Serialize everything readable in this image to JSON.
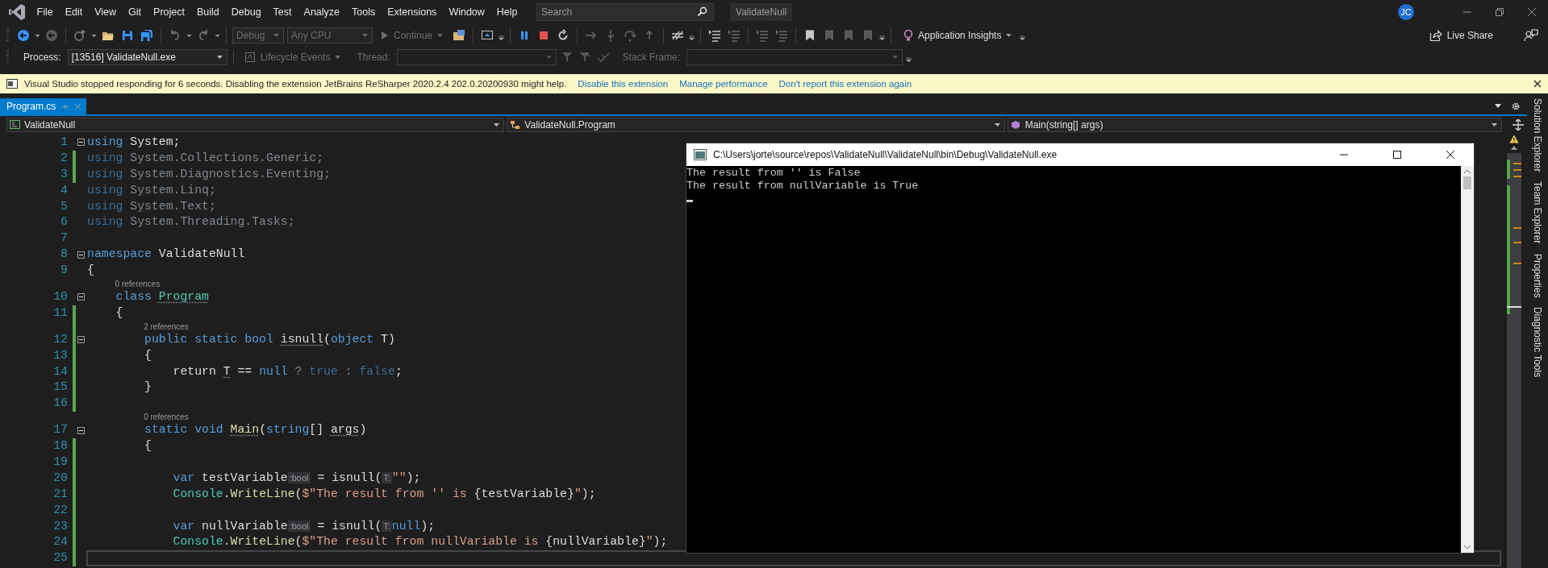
{
  "menu_bar": {
    "items": [
      "File",
      "Edit",
      "View",
      "Git",
      "Project",
      "Build",
      "Debug",
      "Test",
      "Analyze",
      "Tools",
      "Extensions",
      "Window",
      "Help"
    ],
    "search": {
      "placeholder": "Search"
    },
    "solution": "ValidateNull",
    "avatar": "JC"
  },
  "debug_toolbar": {
    "configuration": {
      "value": "Debug",
      "disabled": true
    },
    "platform": {
      "value": "Any CPU",
      "disabled": true
    },
    "continue": {
      "label": "Continue",
      "disabled": true
    },
    "insights": "Application Insights",
    "live_share": "Live Share"
  },
  "process_toolbar": {
    "process_label": "Process:",
    "process": "[13516] ValidateNull.exe",
    "lifecycle": {
      "label": "Lifecycle Events",
      "disabled": true
    },
    "thread_label": "Thread:",
    "stack_frame_label": "Stack Frame:"
  },
  "info_bar": {
    "message": "Visual Studio stopped responding for 6 seconds. Disabling the extension JetBrains ReSharper 2020.2.4 202.0.20200930 might help.",
    "links": [
      "Disable this extension",
      "Manage performance",
      "Don't report this extension again"
    ]
  },
  "tabs": [
    {
      "label": "Program.cs",
      "selected": true
    }
  ],
  "nav_bar": {
    "project": "ValidateNull",
    "type": "ValidateNull.Program",
    "member": "Main(string[] args)"
  },
  "editor": {
    "lines": [
      {
        "number": "1",
        "changed": false,
        "fold": true,
        "current": false,
        "tokens": [
          {
            "kind": "keyword",
            "text": "using"
          },
          {
            "kind": "plain",
            "text": " System;"
          }
        ]
      },
      {
        "number": "2",
        "changed": true,
        "fold": false,
        "current": false,
        "tokens": [
          {
            "kind": "dim-keyword",
            "text": "using"
          },
          {
            "kind": "dim",
            "text": " System.Collections.Generic;"
          }
        ]
      },
      {
        "number": "3",
        "changed": true,
        "fold": false,
        "current": false,
        "tokens": [
          {
            "kind": "dim-keyword",
            "text": "using"
          },
          {
            "kind": "dim",
            "text": " System.Diagnostics.Eventing;"
          }
        ]
      },
      {
        "number": "4",
        "changed": false,
        "fold": false,
        "current": false,
        "tokens": [
          {
            "kind": "dim-keyword",
            "text": "using"
          },
          {
            "kind": "dim",
            "text": " System.Linq;"
          }
        ]
      },
      {
        "number": "5",
        "changed": false,
        "fold": false,
        "current": false,
        "tokens": [
          {
            "kind": "dim-keyword",
            "text": "using"
          },
          {
            "kind": "dim",
            "text": " System.Text;"
          }
        ]
      },
      {
        "number": "6",
        "changed": false,
        "fold": false,
        "current": false,
        "tokens": [
          {
            "kind": "dim-keyword",
            "text": "using"
          },
          {
            "kind": "dim",
            "text": " System.Threading.Tasks;"
          }
        ]
      },
      {
        "number": "7",
        "changed": false,
        "fold": false,
        "current": false
      },
      {
        "number": "8",
        "changed": false,
        "fold": true,
        "current": false,
        "tokens": [
          {
            "kind": "keyword",
            "text": "namespace"
          },
          {
            "kind": "plain",
            "text": " ValidateNull"
          }
        ]
      },
      {
        "number": "9",
        "changed": false,
        "fold": false,
        "current": false,
        "tokens": [
          {
            "kind": "plain",
            "text": "{"
          }
        ]
      },
      {
        "number": "10",
        "changed": false,
        "fold": true,
        "current": false,
        "codelens": "0 references",
        "tokens": [
          {
            "kind": "keyword",
            "text": "    class "
          },
          {
            "kind": "type",
            "text": "Program",
            "squiggle": true
          }
        ]
      },
      {
        "number": "11",
        "changed": true,
        "fold": false,
        "current": false,
        "tokens": [
          {
            "kind": "plain",
            "text": "    {"
          }
        ]
      },
      {
        "number": "12",
        "changed": true,
        "fold": true,
        "current": false,
        "codelens": "2 references",
        "tokens": [
          {
            "kind": "keyword",
            "text": "        public static bool "
          },
          {
            "kind": "plain",
            "text": "isnull",
            "squiggle": true
          },
          {
            "kind": "plain",
            "text": "("
          },
          {
            "kind": "keyword",
            "text": "object"
          },
          {
            "kind": "plain",
            "text": " T)"
          }
        ]
      },
      {
        "number": "13",
        "changed": true,
        "fold": false,
        "current": false,
        "tokens": [
          {
            "kind": "plain",
            "text": "        {"
          }
        ]
      },
      {
        "number": "14",
        "changed": true,
        "fold": false,
        "current": false,
        "tokens": [
          {
            "kind": "plain",
            "text": "            return "
          },
          {
            "kind": "plain",
            "text": "T",
            "squiggle": true
          },
          {
            "kind": "plain",
            "text": " == "
          },
          {
            "kind": "keyword",
            "text": "null"
          },
          {
            "kind": "dim",
            "text": " ? "
          },
          {
            "kind": "dim-keyword",
            "text": "true"
          },
          {
            "kind": "dim",
            "text": " : "
          },
          {
            "kind": "dim-keyword",
            "text": "false"
          },
          {
            "kind": "plain",
            "text": ";"
          }
        ]
      },
      {
        "number": "15",
        "changed": true,
        "fold": false,
        "current": false,
        "tokens": [
          {
            "kind": "plain",
            "text": "        }"
          }
        ]
      },
      {
        "number": "16",
        "changed": true,
        "fold": false,
        "current": false
      },
      {
        "number": "17",
        "changed": false,
        "fold": true,
        "current": false,
        "codelens": "0 references",
        "tokens": [
          {
            "kind": "keyword",
            "text": "        static void "
          },
          {
            "kind": "method",
            "text": "Main",
            "squiggle": true
          },
          {
            "kind": "plain",
            "text": "("
          },
          {
            "kind": "keyword",
            "text": "string"
          },
          {
            "kind": "plain",
            "text": "[] "
          },
          {
            "kind": "plain",
            "text": "args",
            "squiggle": true
          },
          {
            "kind": "plain",
            "text": ")"
          }
        ]
      },
      {
        "number": "18",
        "changed": true,
        "fold": false,
        "current": false,
        "tokens": [
          {
            "kind": "plain",
            "text": "        {"
          }
        ]
      },
      {
        "number": "19",
        "changed": true,
        "fold": false,
        "current": false
      },
      {
        "number": "20",
        "changed": true,
        "fold": false,
        "current": false,
        "tokens": [
          {
            "kind": "keyword",
            "text": "            var"
          },
          {
            "kind": "plain",
            "text": " testVariable"
          },
          {
            "kind": "hint",
            "text": ":bool"
          },
          {
            "kind": "plain",
            "text": " = isnull("
          },
          {
            "kind": "hint",
            "text": "T:"
          },
          {
            "kind": "string",
            "text": "\"\""
          },
          {
            "kind": "plain",
            "text": ");"
          }
        ]
      },
      {
        "number": "21",
        "changed": true,
        "fold": false,
        "current": false,
        "tokens": [
          {
            "kind": "type",
            "text": "            Console"
          },
          {
            "kind": "plain",
            "text": "."
          },
          {
            "kind": "method",
            "text": "WriteLine"
          },
          {
            "kind": "plain",
            "text": "("
          },
          {
            "kind": "string",
            "text": "$\"The result from '' is "
          },
          {
            "kind": "plain",
            "text": "{testVariable}"
          },
          {
            "kind": "string",
            "text": "\""
          },
          {
            "kind": "plain",
            "text": ");"
          }
        ]
      },
      {
        "number": "22",
        "changed": true,
        "fold": false,
        "current": false
      },
      {
        "number": "23",
        "changed": true,
        "fold": false,
        "current": false,
        "tokens": [
          {
            "kind": "keyword",
            "text": "            var"
          },
          {
            "kind": "plain",
            "text": " nullVariable"
          },
          {
            "kind": "hint",
            "text": ":bool"
          },
          {
            "kind": "plain",
            "text": " = isnull("
          },
          {
            "kind": "hint",
            "text": "T:"
          },
          {
            "kind": "keyword",
            "text": "null"
          },
          {
            "kind": "plain",
            "text": ");"
          }
        ]
      },
      {
        "number": "24",
        "changed": true,
        "fold": false,
        "current": false,
        "tokens": [
          {
            "kind": "type",
            "text": "            Console"
          },
          {
            "kind": "plain",
            "text": "."
          },
          {
            "kind": "method",
            "text": "WriteLine"
          },
          {
            "kind": "plain",
            "text": "("
          },
          {
            "kind": "string",
            "text": "$\"The result from nullVariable is "
          },
          {
            "kind": "plain",
            "text": "{nullVariable}"
          },
          {
            "kind": "string",
            "text": "\""
          },
          {
            "kind": "plain",
            "text": ");"
          }
        ]
      },
      {
        "number": "25",
        "changed": true,
        "fold": false,
        "current": true
      }
    ]
  },
  "console": {
    "title": "C:\\Users\\jorte\\source\\repos\\ValidateNull\\ValidateNull\\bin\\Debug\\ValidateNull.exe",
    "output": [
      "The result from '' is False",
      "The result from nullVariable is True"
    ]
  },
  "side_tabs": [
    "Solution Explorer",
    "Team Explorer",
    "Properties",
    "Diagnostic Tools"
  ]
}
